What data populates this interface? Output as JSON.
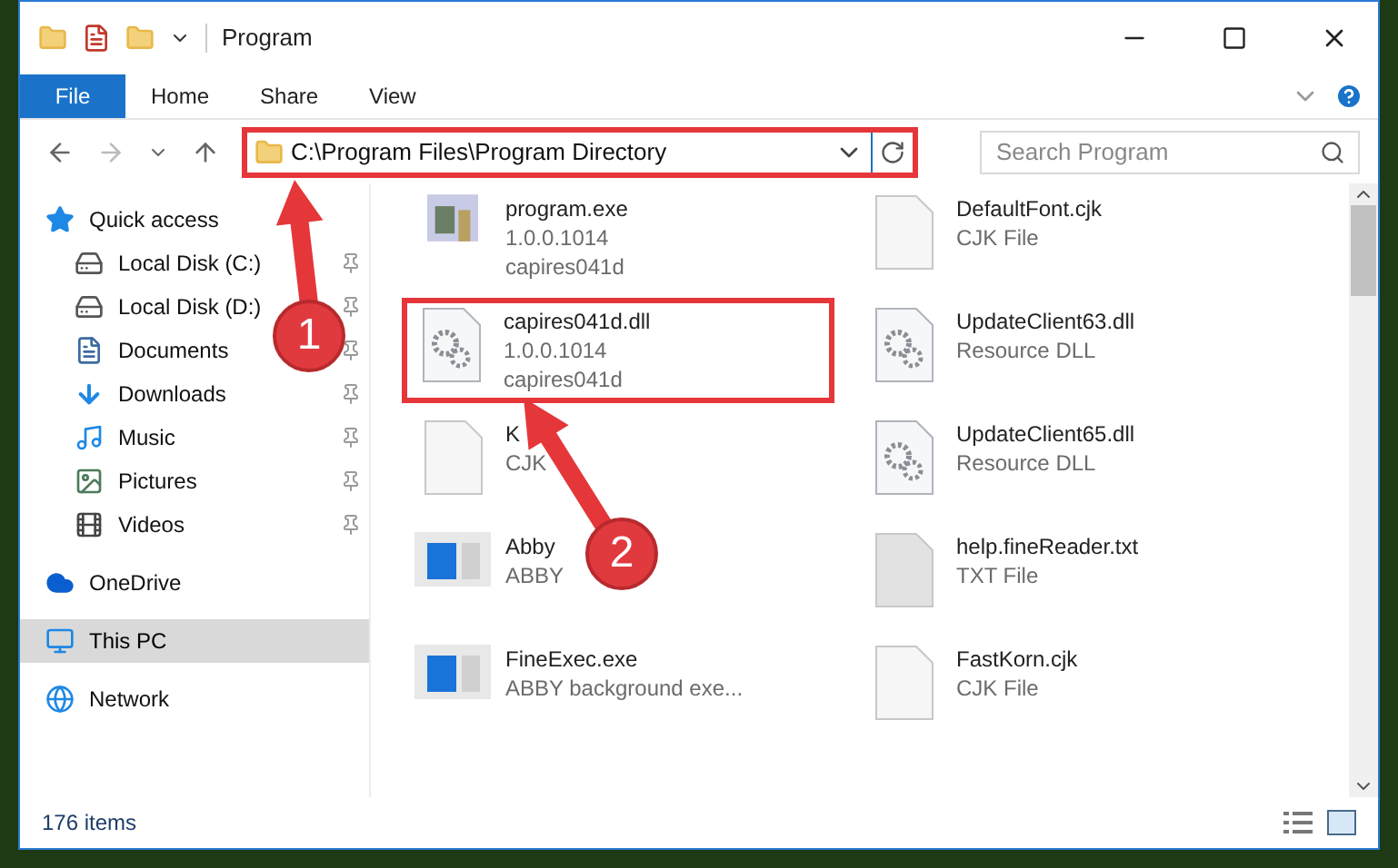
{
  "window": {
    "title": "Program"
  },
  "ribbon": {
    "tabs": [
      {
        "label": "File",
        "selected": true
      },
      {
        "label": "Home",
        "selected": false
      },
      {
        "label": "Share",
        "selected": false
      },
      {
        "label": "View",
        "selected": false
      }
    ]
  },
  "address": {
    "path": "C:\\Program Files\\Program Directory",
    "highlighted": true
  },
  "search": {
    "placeholder": "Search Program"
  },
  "sidebar": {
    "items": [
      {
        "label": "Quick access",
        "kind": "star",
        "selected": false,
        "children": [
          {
            "label": "Local Disk (C:)",
            "kind": "drive",
            "pinned": true,
            "selected": false
          },
          {
            "label": "Local Disk (D:)",
            "kind": "drive",
            "pinned": true,
            "selected": false
          },
          {
            "label": "Documents",
            "kind": "document",
            "pinned": true,
            "selected": false
          },
          {
            "label": "Downloads",
            "kind": "download",
            "pinned": true,
            "selected": false
          },
          {
            "label": "Music",
            "kind": "music",
            "pinned": true,
            "selected": false
          },
          {
            "label": "Pictures",
            "kind": "pictures",
            "pinned": true,
            "selected": false
          },
          {
            "label": "Videos",
            "kind": "video",
            "pinned": true,
            "selected": false
          }
        ]
      },
      {
        "label": "OneDrive",
        "kind": "cloud",
        "selected": false
      },
      {
        "label": "This PC",
        "kind": "pc",
        "selected": true
      },
      {
        "label": "Network",
        "kind": "network",
        "selected": false
      }
    ]
  },
  "files": [
    {
      "name": "program.exe",
      "line_2": "1.0.0.1014",
      "line_3": "capires041d",
      "kind": "exe",
      "highlighted": false
    },
    {
      "name": "DefaultFont.cjk",
      "line_2": "CJK File",
      "kind": "blank",
      "highlighted": false
    },
    {
      "name": "capires041d.dll",
      "line_2": "1.0.0.1014",
      "line_3": "capires041d",
      "kind": "dll",
      "highlighted": true
    },
    {
      "name": "UpdateClient63.dll",
      "line_2": "Resource DLL",
      "kind": "dll",
      "highlighted": false
    },
    {
      "name": "K",
      "line_2": "CJK",
      "kind": "blank",
      "highlighted": false
    },
    {
      "name": "UpdateClient65.dll",
      "line_2": "Resource DLL",
      "kind": "dll",
      "highlighted": false
    },
    {
      "name": "Abby",
      "line_2": "ABBY",
      "kind": "app",
      "highlighted": false
    },
    {
      "name": "help.fineReader.txt",
      "line_2": "TXT File",
      "kind": "text",
      "highlighted": false
    },
    {
      "name": "FineExec.exe",
      "line_2": "ABBY background exe...",
      "kind": "app",
      "highlighted": false
    },
    {
      "name": "FastKorn.cjk",
      "line_2": "CJK File",
      "kind": "blank",
      "highlighted": false
    }
  ],
  "callouts": [
    {
      "label": "1"
    },
    {
      "label": "2"
    }
  ],
  "status_bar": {
    "item_count": "176 items"
  }
}
